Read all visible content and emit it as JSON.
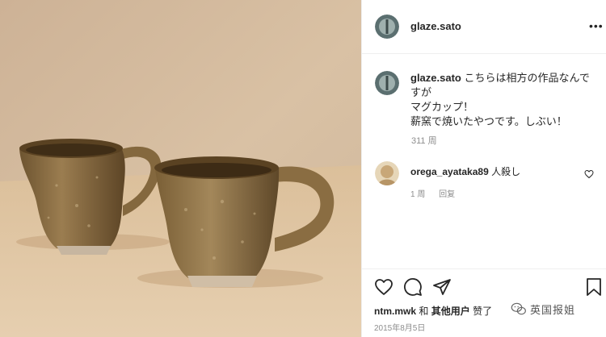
{
  "post": {
    "username": "glaze.sato",
    "caption_lines": [
      "こちらは相方の作品なんですが",
      "マグカップ！",
      "薪窯で焼いたやつです。しぶい！"
    ],
    "caption_time": "311 周",
    "date": "2015年8月5日"
  },
  "comment": {
    "username": "orega_ayataka89",
    "text": "人殺し",
    "time": "1 周",
    "reply_label": "回复"
  },
  "likes": {
    "user": "ntm.mwk",
    "joiner": "和",
    "others": "其他用户",
    "suffix": "赞了"
  },
  "icons": {
    "more": "more-icon",
    "like": "heart-icon",
    "comment": "comment-icon",
    "share": "share-icon",
    "save": "bookmark-icon",
    "comment_like": "heart-icon"
  },
  "watermark": {
    "text": "英国报姐"
  },
  "colors": {
    "text": "#262626",
    "muted": "#8e8e8e",
    "divider": "#efefef",
    "glaze": "#8a6a3e"
  }
}
